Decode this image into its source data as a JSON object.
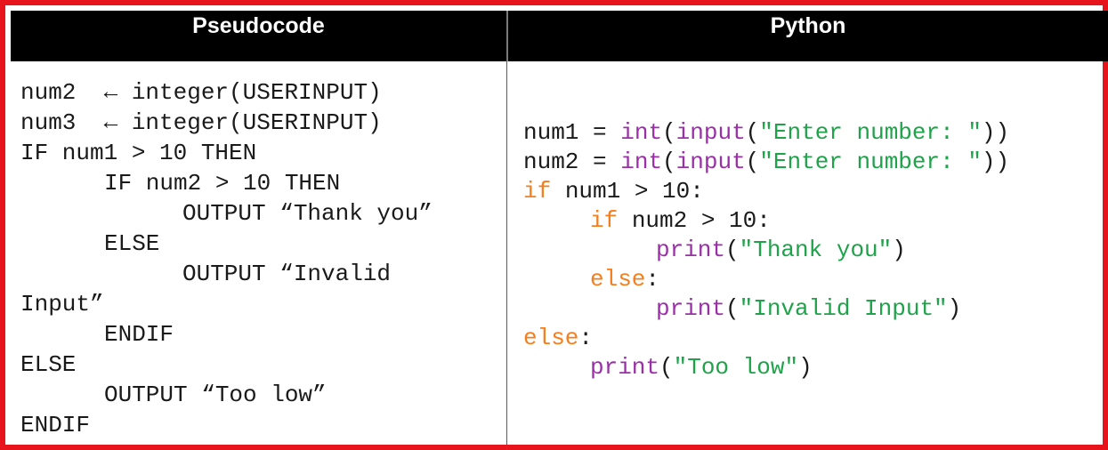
{
  "headers": {
    "left": "Pseudocode",
    "right": "Python"
  },
  "pseudocode": {
    "lines": [
      "num2  ← integer(USERINPUT)",
      "num3  ← integer(USERINPUT)",
      "IF num1 > 10 THEN",
      "IF num2 > 10 THEN",
      "OUTPUT “Thank you”",
      "ELSE",
      "OUTPUT “Invalid",
      "Input”",
      "ENDIF",
      "ELSE",
      "OUTPUT “Too low”",
      "ENDIF"
    ]
  },
  "python": {
    "l1": {
      "var": "num1",
      "op": " = ",
      "fn1": "int",
      "p1": "(",
      "fn2": "input",
      "p2": "(",
      "str": "\"Enter number: \"",
      "close": "))"
    },
    "l2": {
      "var": "num2",
      "op": " = ",
      "fn1": "int",
      "p1": "(",
      "fn2": "input",
      "p2": "(",
      "str": "\"Enter number: \"",
      "close": "))"
    },
    "l3": {
      "kw": "if",
      "rest": " num1 > 10:"
    },
    "l4": {
      "kw": "if",
      "rest": " num2 > 10:"
    },
    "l5": {
      "fn": "print",
      "open": "(",
      "str": "\"Thank you\"",
      "close": ")"
    },
    "l6": {
      "kw": "else",
      "rest": ":"
    },
    "l7": {
      "fn": "print",
      "open": "(",
      "str": "\"Invalid Input\"",
      "close": ")"
    },
    "l8": {
      "kw": "else",
      "rest": ":"
    },
    "l9": {
      "fn": "print",
      "open": "(",
      "str": "\"Too low\"",
      "close": ")"
    }
  },
  "colors": {
    "border": "#e8141b",
    "header_bg": "#000000",
    "keyword": "#f57f1f",
    "function": "#9a2fa8",
    "string": "#1fa34a"
  }
}
